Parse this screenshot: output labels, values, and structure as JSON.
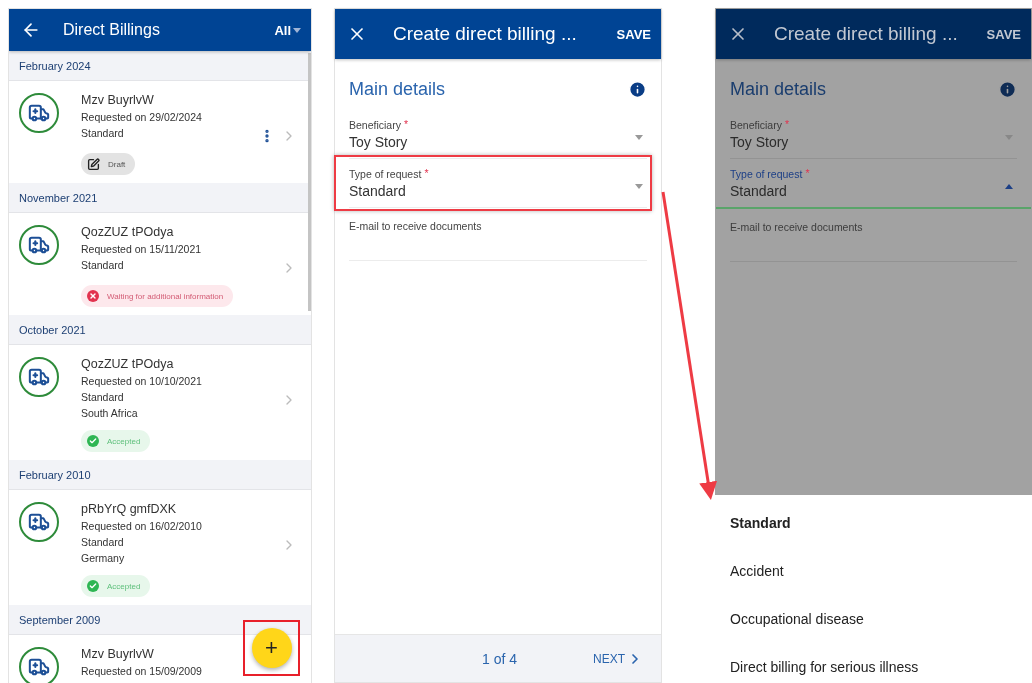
{
  "list_screen": {
    "title": "Direct Billings",
    "filter": "All",
    "groups": [
      {
        "month": "February 2024",
        "items": [
          {
            "name": "Mzv BuyrlvW",
            "requested": "Requested on 29/02/2024",
            "lines": [
              "Standard"
            ],
            "has_menu": true,
            "status": {
              "kind": "draft",
              "label": "Draft"
            }
          }
        ]
      },
      {
        "month": "November 2021",
        "items": [
          {
            "name": "QozZUZ tPOdya",
            "requested": "Requested on 15/11/2021",
            "lines": [
              "Standard"
            ],
            "status": {
              "kind": "waiting",
              "label": "Waiting for additional information"
            }
          }
        ]
      },
      {
        "month": "October 2021",
        "items": [
          {
            "name": "QozZUZ tPOdya",
            "requested": "Requested on 10/10/2021",
            "lines": [
              "Standard",
              "South Africa"
            ],
            "status": {
              "kind": "accepted",
              "label": "Accepted"
            }
          }
        ]
      },
      {
        "month": "February 2010",
        "items": [
          {
            "name": "pRbYrQ gmfDXK",
            "requested": "Requested on 16/02/2010",
            "lines": [
              "Standard",
              "Germany"
            ],
            "status": {
              "kind": "accepted",
              "label": "Accepted"
            }
          }
        ]
      },
      {
        "month": "September 2009",
        "items": [
          {
            "name": "Mzv BuyrlvW",
            "requested": "Requested on 15/09/2009"
          }
        ]
      }
    ],
    "fab": "+"
  },
  "form_screen": {
    "title": "Create direct billing ...",
    "action": "SAVE",
    "section": "Main details",
    "fields": [
      {
        "kind": "select",
        "label": "Beneficiary",
        "required_mark": "*",
        "value": "Toy Story"
      },
      {
        "kind": "select",
        "label": "Type of request",
        "required_mark": "*",
        "value": "Standard",
        "highlighted": true
      },
      {
        "kind": "text",
        "label": "E-mail to receive documents"
      }
    ],
    "pager": "1 of 4",
    "next": "NEXT"
  },
  "dimmed_form_screen": {
    "title": "Create direct billing ...",
    "action": "SAVE",
    "section": "Main details",
    "fields": [
      {
        "kind": "select",
        "label": "Beneficiary",
        "required_mark": "*",
        "value": "Toy Story"
      },
      {
        "kind": "select",
        "label": "Type of request",
        "required_mark": "*",
        "value": "Standard",
        "focused": true
      },
      {
        "kind": "text",
        "label": "E-mail to receive documents"
      }
    ]
  },
  "request_type_options": [
    {
      "label": "Standard",
      "selected": true
    },
    {
      "label": "Accident",
      "selected": false
    },
    {
      "label": "Occupational disease",
      "selected": false
    },
    {
      "label": "Direct billing for serious illness",
      "selected": false
    }
  ]
}
